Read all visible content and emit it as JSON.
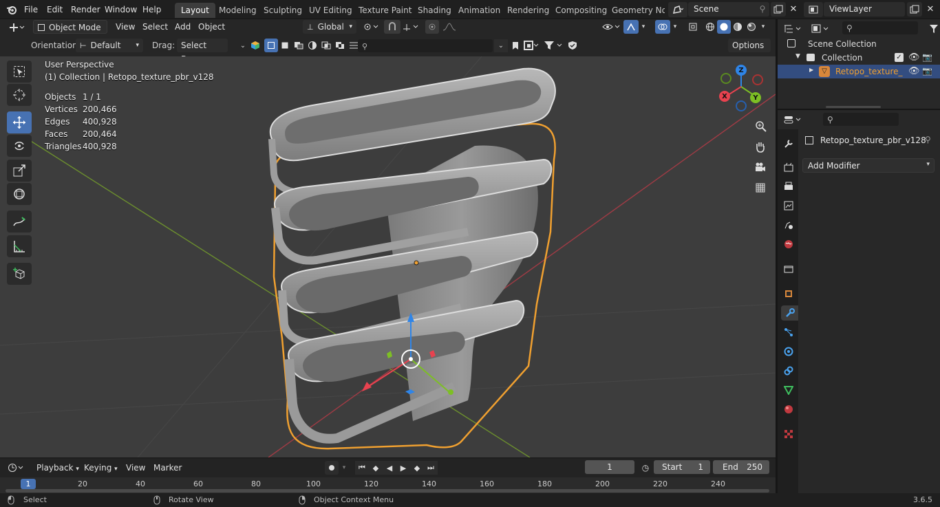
{
  "menus": [
    "File",
    "Edit",
    "Render",
    "Window",
    "Help"
  ],
  "workspaces": [
    "Layout",
    "Modeling",
    "Sculpting",
    "UV Editing",
    "Texture Paint",
    "Shading",
    "Animation",
    "Rendering",
    "Compositing",
    "Geometry Noc"
  ],
  "active_workspace": "Layout",
  "scene": {
    "label": "Scene"
  },
  "view_layer": {
    "label": "ViewLayer"
  },
  "viewport_header": {
    "mode": "Object Mode",
    "view": "View",
    "select": "Select",
    "add": "Add",
    "object": "Object",
    "transform": "Global",
    "orientation_label": "Orientation:",
    "orientation_value": "Default",
    "drag_label": "Drag:",
    "drag_value": "Select Box",
    "options": "Options"
  },
  "overlay": {
    "perspective": "User Perspective",
    "collection": "(1) Collection | Retopo_texture_pbr_v128",
    "stats": [
      {
        "label": "Objects",
        "value": "1 / 1"
      },
      {
        "label": "Vertices",
        "value": "200,466"
      },
      {
        "label": "Edges",
        "value": "400,928"
      },
      {
        "label": "Faces",
        "value": "200,464"
      },
      {
        "label": "Triangles",
        "value": "400,928"
      }
    ]
  },
  "gizmo": {
    "x": "X",
    "y": "Y",
    "z": "Z"
  },
  "timeline": {
    "playback": "Playback",
    "keying": "Keying",
    "view": "View",
    "marker": "Marker",
    "current_frame": "1",
    "start_label": "Start",
    "start": "1",
    "end_label": "End",
    "end": "250",
    "ruler": [
      "1",
      "20",
      "40",
      "60",
      "80",
      "100",
      "120",
      "140",
      "160",
      "180",
      "200",
      "220",
      "240"
    ]
  },
  "outliner": {
    "root": "Scene Collection",
    "collection": "Collection",
    "object": "Retopo_texture_"
  },
  "properties": {
    "object_name": "Retopo_texture_pbr_v128",
    "add_modifier": "Add Modifier"
  },
  "status": {
    "select": "Select",
    "rotate": "Rotate View",
    "context": "Object Context Menu",
    "version": "3.6.5"
  },
  "colors": {
    "accent": "#4772b3",
    "selection": "#f0a030",
    "x_axis": "#e8424f",
    "y_axis": "#7dbf24",
    "z_axis": "#2f85e8"
  }
}
